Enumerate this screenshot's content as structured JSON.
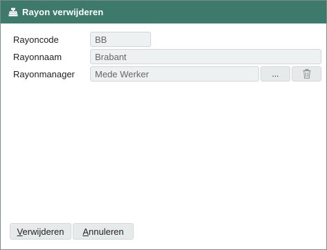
{
  "dialog": {
    "title": "Rayon verwijderen",
    "title_icon": "cash-register-icon"
  },
  "form": {
    "rayoncode": {
      "label": "Rayoncode",
      "value": "BB"
    },
    "rayonnaam": {
      "label": "Rayonnaam",
      "value": "Brabant"
    },
    "rayonmanager": {
      "label": "Rayonmanager",
      "value": "Mede Werker",
      "browse_label": "...",
      "delete_icon": "trash-icon"
    }
  },
  "buttons": {
    "delete": {
      "hotkey": "V",
      "rest": "erwijderen"
    },
    "cancel": {
      "hotkey": "A",
      "rest": "nnuleren"
    }
  },
  "colors": {
    "titlebar": "#3d7a6c",
    "field_bg": "#eef1f1",
    "button_bg": "#e6eaea"
  }
}
